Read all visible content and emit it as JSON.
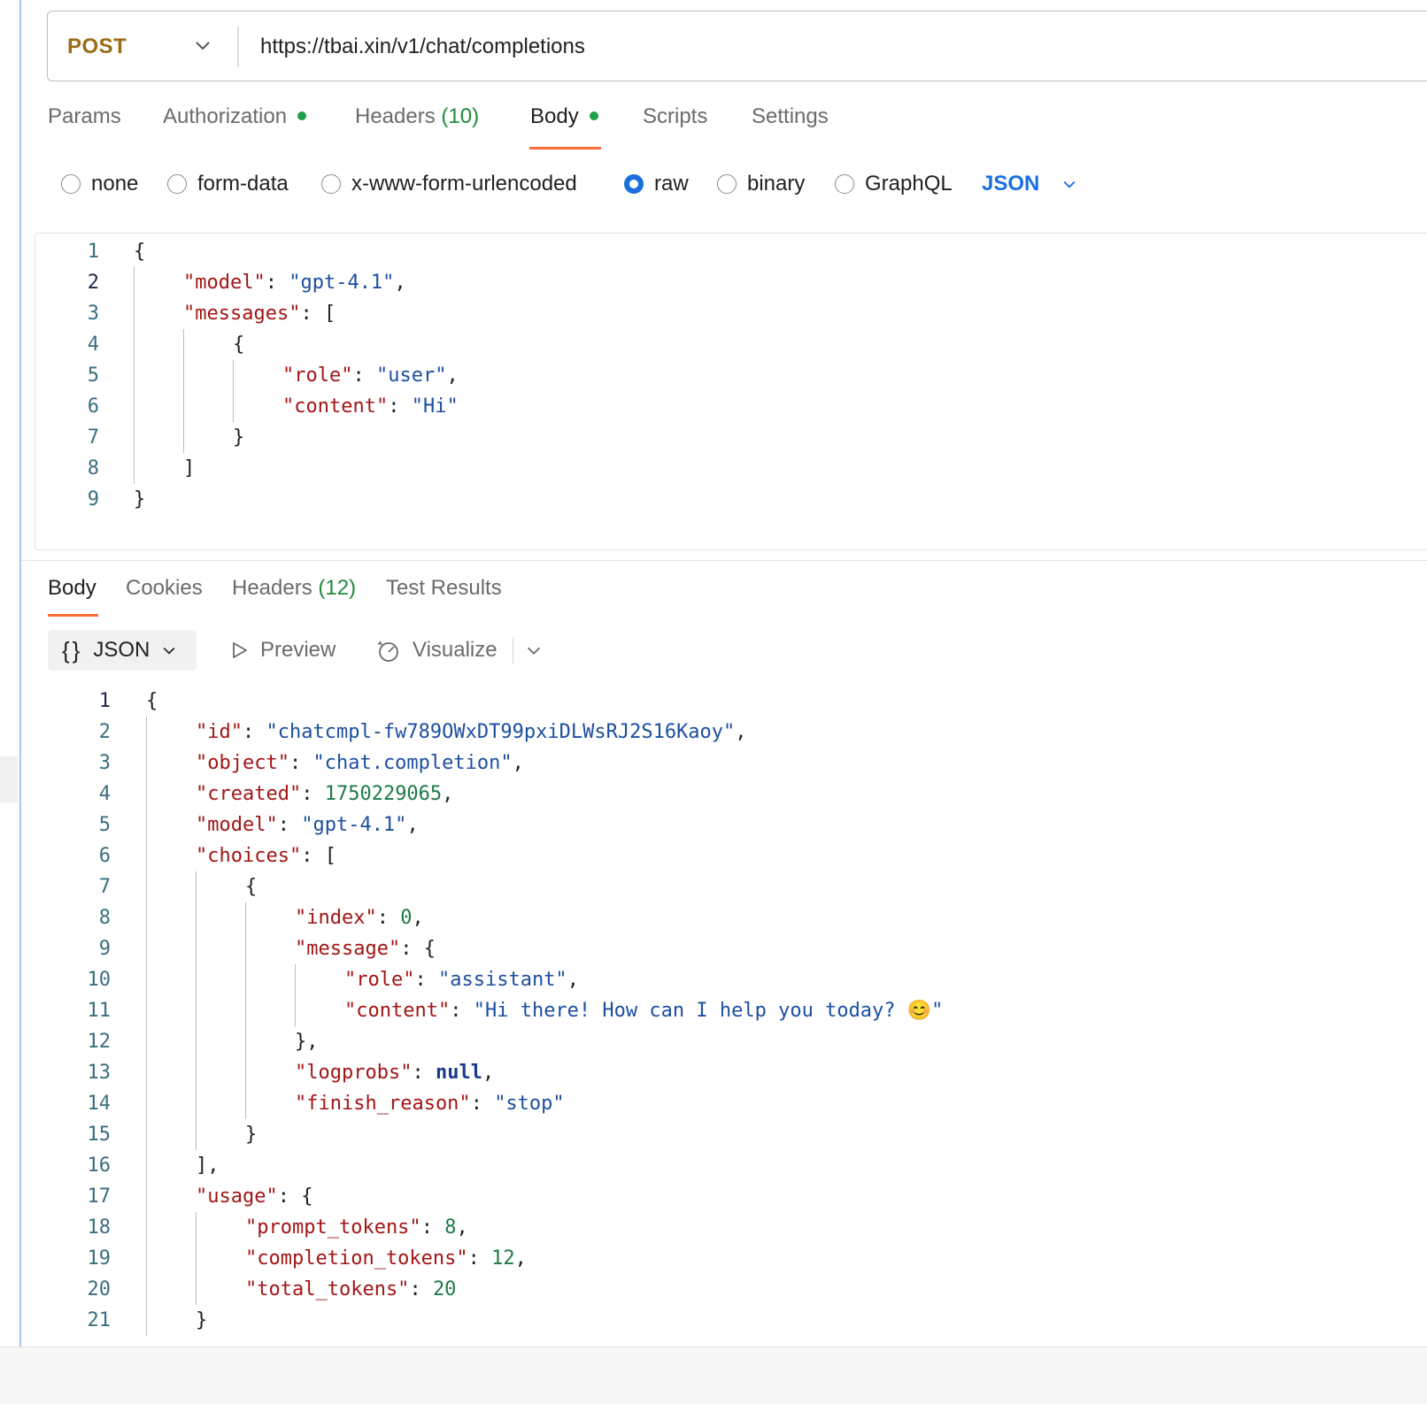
{
  "request": {
    "method": "POST",
    "url": "https://tbai.xin/v1/chat/completions",
    "tabs": [
      {
        "label": "Params"
      },
      {
        "label": "Authorization"
      },
      {
        "label": "Headers",
        "count": "(10)"
      },
      {
        "label": "Body"
      },
      {
        "label": "Scripts"
      },
      {
        "label": "Settings"
      }
    ],
    "active_tab": "Body",
    "body_types": [
      "none",
      "form-data",
      "x-www-form-urlencoded",
      "raw",
      "binary",
      "GraphQL"
    ],
    "selected_body_type": "raw",
    "raw_format": "JSON",
    "line_numbers": [
      "1",
      "2",
      "3",
      "4",
      "5",
      "6",
      "7",
      "8",
      "9"
    ],
    "keys": {
      "model": "\"model\"",
      "messages": "\"messages\"",
      "role": "\"role\"",
      "content": "\"content\""
    },
    "values": {
      "model": "\"gpt-4.1\"",
      "role": "\"user\"",
      "content": "\"Hi\""
    }
  },
  "response": {
    "tabs": [
      {
        "label": "Body"
      },
      {
        "label": "Cookies"
      },
      {
        "label": "Headers",
        "count": "(12)"
      },
      {
        "label": "Test Results"
      }
    ],
    "active_tab": "Body",
    "format_label": "JSON",
    "preview_label": "Preview",
    "visualize_label": "Visualize",
    "line_numbers": [
      "1",
      "2",
      "3",
      "4",
      "5",
      "6",
      "7",
      "8",
      "9",
      "10",
      "11",
      "12",
      "13",
      "14",
      "15",
      "16",
      "17",
      "18",
      "19",
      "20",
      "21"
    ],
    "keys": {
      "id": "\"id\"",
      "object": "\"object\"",
      "created": "\"created\"",
      "model": "\"model\"",
      "choices": "\"choices\"",
      "index": "\"index\"",
      "message": "\"message\"",
      "role": "\"role\"",
      "content": "\"content\"",
      "logprobs": "\"logprobs\"",
      "finish_reason": "\"finish_reason\"",
      "usage": "\"usage\"",
      "prompt_tokens": "\"prompt_tokens\"",
      "completion_tokens": "\"completion_tokens\"",
      "total_tokens": "\"total_tokens\""
    },
    "values": {
      "id": "\"chatcmpl-fw789OWxDT99pxiDLWsRJ2S16Kaoy\"",
      "object": "\"chat.completion\"",
      "created": "1750229065",
      "model": "\"gpt-4.1\"",
      "index": "0",
      "role": "\"assistant\"",
      "content": "\"Hi there! How can I help you today? 😊\"",
      "logprobs": "null",
      "finish_reason": "\"stop\"",
      "prompt_tokens": "8",
      "completion_tokens": "12",
      "total_tokens": "20"
    }
  },
  "colors": {
    "method": "#9a6b16",
    "accent": "#ff6c37",
    "link_blue": "#1a6fe0",
    "status_dot": "#1ea04c"
  }
}
